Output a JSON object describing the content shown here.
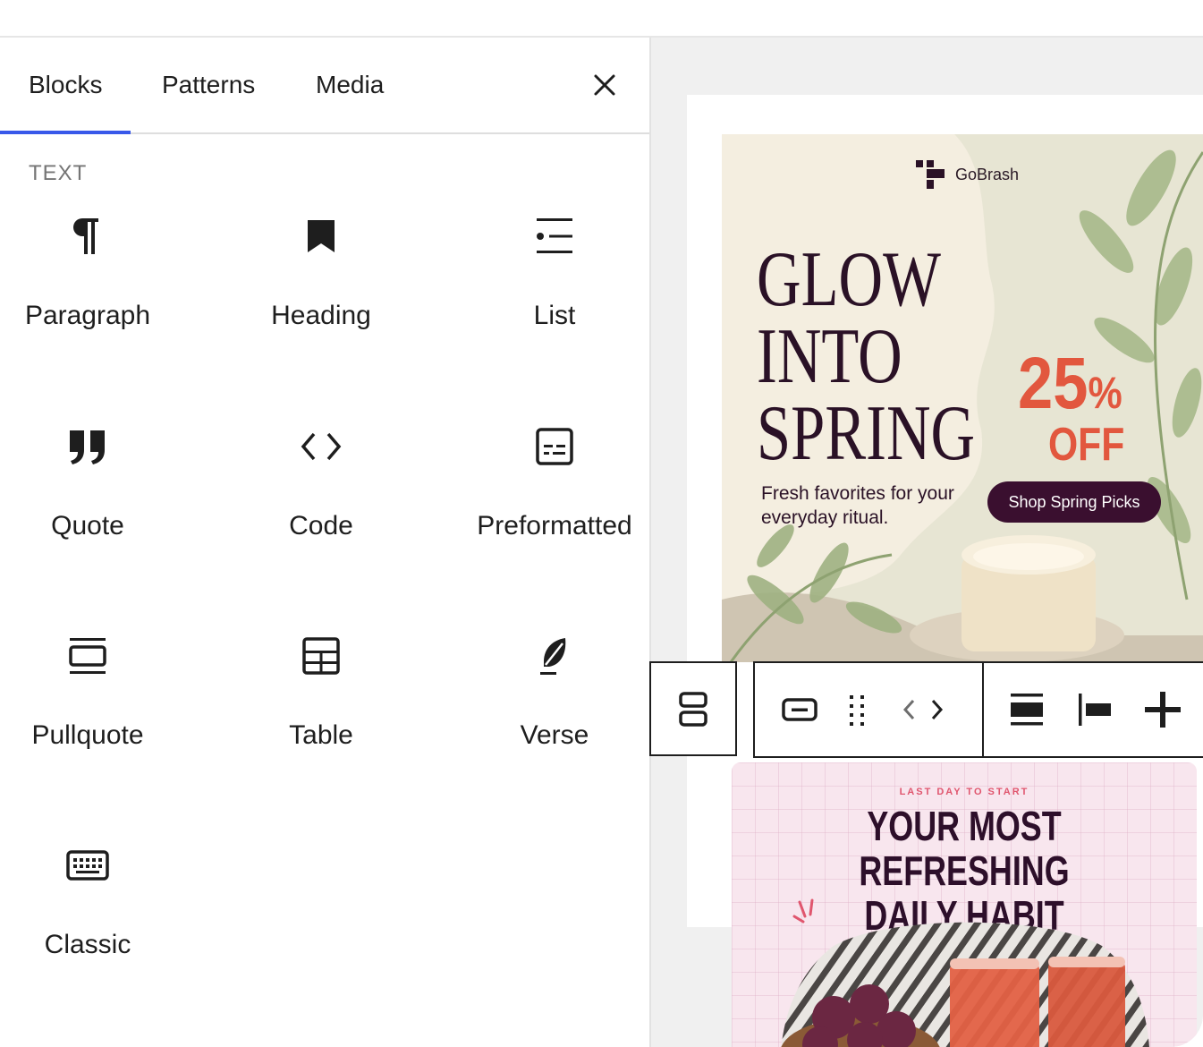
{
  "inserter": {
    "tabs": [
      {
        "label": "Blocks",
        "active": true
      },
      {
        "label": "Patterns",
        "active": false
      },
      {
        "label": "Media",
        "active": false
      }
    ],
    "close_icon": "close-icon",
    "section_title": "TEXT",
    "blocks": [
      {
        "label": "Paragraph",
        "icon": "paragraph-icon"
      },
      {
        "label": "Heading",
        "icon": "heading-bookmark-icon"
      },
      {
        "label": "List",
        "icon": "list-icon"
      },
      {
        "label": "Quote",
        "icon": "quote-icon"
      },
      {
        "label": "Code",
        "icon": "code-icon"
      },
      {
        "label": "Preformatted",
        "icon": "preformatted-icon"
      },
      {
        "label": "Pullquote",
        "icon": "pullquote-icon"
      },
      {
        "label": "Table",
        "icon": "table-icon"
      },
      {
        "label": "Verse",
        "icon": "verse-feather-icon"
      },
      {
        "label": "Classic",
        "icon": "keyboard-icon"
      }
    ]
  },
  "canvas": {
    "banner1": {
      "brand": "GoBrash",
      "headline": [
        "GLOW",
        "INTO",
        "SPRING"
      ],
      "subtext": "Fresh favorites for your everyday ritual.",
      "discount_value": "25",
      "discount_unit": "%",
      "discount_word": "OFF",
      "cta": "Shop Spring Picks",
      "colors": {
        "headline": "#2a1126",
        "accent": "#e2573e",
        "cta_bg": "#3a0f2f",
        "background": "#e7e5d3"
      }
    },
    "toolbar": {
      "buttons": [
        "block-type-group-icon",
        "block-icon",
        "drag-handle-icon",
        "move-arrows-icon",
        "align-wide-icon",
        "justify-left-icon",
        "add-icon"
      ]
    },
    "banner2": {
      "eyebrow": "LAST DAY TO START",
      "title": [
        "YOUR MOST REFRESHING",
        "DAILY HABIT"
      ],
      "colors": {
        "title": "#2d0f2a",
        "eyebrow": "#e0566e",
        "background": "#f8e6ee"
      }
    }
  },
  "accent_color": "#3858e9"
}
